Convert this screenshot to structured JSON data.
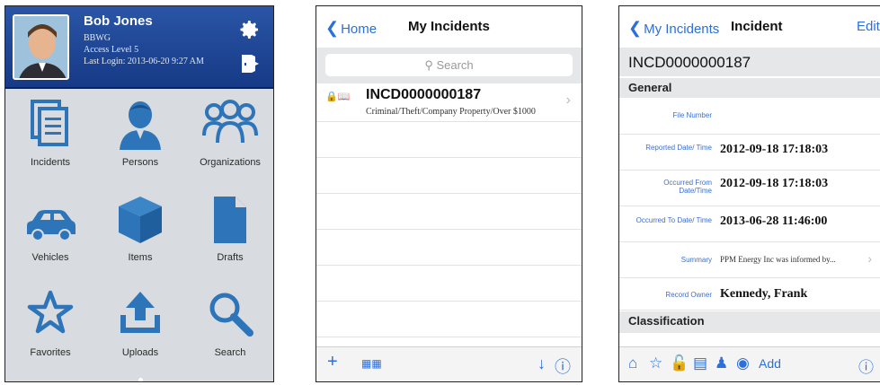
{
  "dashboard": {
    "user_name": "Bob Jones",
    "org": "BBWG",
    "access": "Access Level 5",
    "last_login": "Last Login: 2013-06-20 9:27 AM",
    "tiles": [
      "Incidents",
      "Persons",
      "Organizations",
      "Vehicles",
      "Items",
      "Drafts",
      "Favorites",
      "Uploads",
      "Search"
    ]
  },
  "incident_list": {
    "back_label": "Home",
    "title": "My Incidents",
    "search_placeholder": "Search",
    "row": {
      "id": "INCD0000000187",
      "description": "Criminal/Theft/Company Property/Over $1000"
    }
  },
  "incident_detail": {
    "back_label": "My Incidents",
    "title": "Incident",
    "edit_label": "Edit",
    "incident_id": "INCD0000000187",
    "sections": {
      "general": "General",
      "classification": "Classification"
    },
    "fields": {
      "file_number": {
        "label": "File Number",
        "value": ""
      },
      "reported": {
        "label": "Reported Date/ Time",
        "value": "2012-09-18 17:18:03"
      },
      "occurred_from": {
        "label": "Occurred From Date/Time",
        "value": "2012-09-18 17:18:03"
      },
      "occurred_to": {
        "label": "Occurred To Date/ Time",
        "value": "2013-06-28 11:46:00"
      },
      "summary": {
        "label": "Summary",
        "value": "PPM Energy Inc was informed by..."
      },
      "record_owner": {
        "label": "Record Owner",
        "value": "Kennedy, Frank"
      }
    },
    "toolbar_add_label": "Add"
  },
  "colors": {
    "accent": "#2a6fdb",
    "header_blue": "#1f4a9a",
    "tile_icon": "#2d74b8",
    "list_bg": "#e6e7e9"
  }
}
